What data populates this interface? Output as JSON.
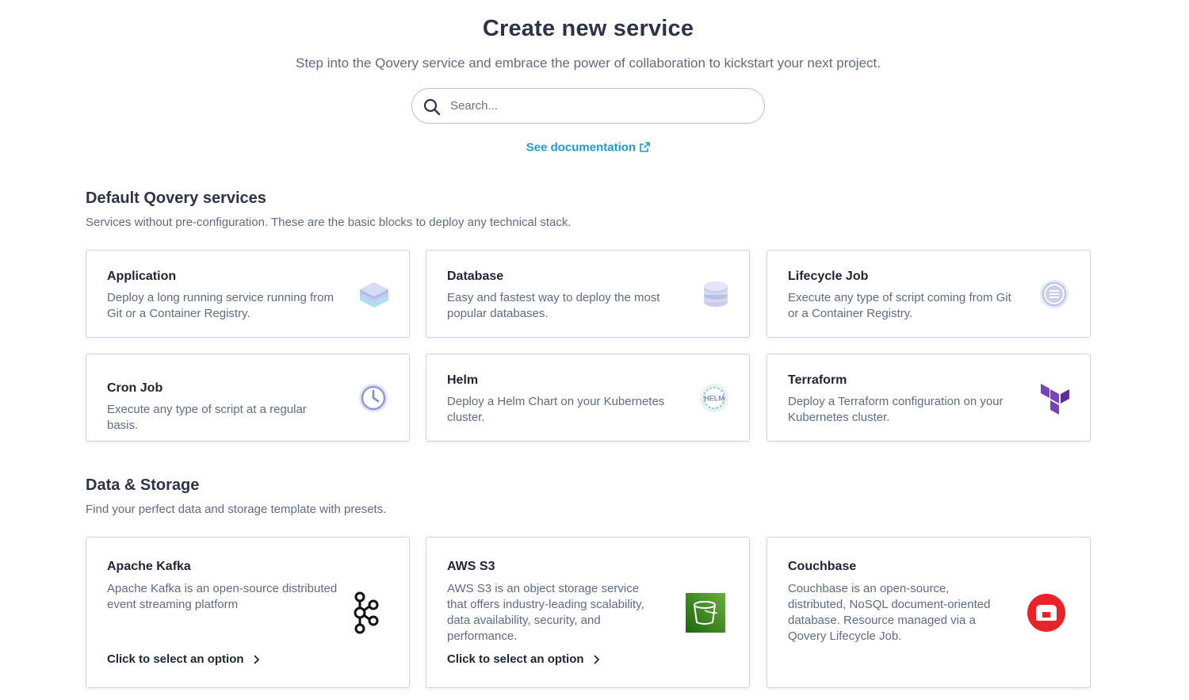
{
  "header": {
    "title": "Create new service",
    "subtitle": "Step into the Qovery service and embrace the power of collaboration to kickstart your next project.",
    "search_placeholder": "Search...",
    "doc_link": "See documentation"
  },
  "sections": [
    {
      "title": "Default Qovery services",
      "description": "Services without pre-configuration. These are the basic blocks to deploy any technical stack.",
      "cards": [
        {
          "title": "Application",
          "description": "Deploy a long running service running from Git or a Container Registry.",
          "icon": "layers-icon"
        },
        {
          "title": "Database",
          "description": "Easy and fastest way to deploy the most popular databases.",
          "icon": "database-icon"
        },
        {
          "title": "Lifecycle Job",
          "description": "Execute any type of script coming from Git or a Container Registry.",
          "icon": "lifecycle-job-icon"
        },
        {
          "title": "Cron Job",
          "description": "Execute any type of script at a regular basis.",
          "icon": "clock-icon"
        },
        {
          "title": "Helm",
          "description": "Deploy a Helm Chart on your Kubernetes cluster.",
          "icon": "helm-icon",
          "icon_text": "HELM"
        },
        {
          "title": "Terraform",
          "description": "Deploy a Terraform configuration on your Kubernetes cluster.",
          "icon": "terraform-icon"
        }
      ]
    },
    {
      "title": "Data & Storage",
      "description": "Find your perfect data and storage template with presets.",
      "cards": [
        {
          "title": "Apache Kafka",
          "description": "Apache Kafka is an open-source distributed event streaming platform",
          "cta": "Click to select an option",
          "icon": "kafka-icon"
        },
        {
          "title": "AWS S3",
          "description": "AWS S3 is an object storage service that offers industry-leading scalability, data availability, security, and performance.",
          "cta": "Click to select an option",
          "icon": "s3-bucket-icon"
        },
        {
          "title": "Couchbase",
          "description": "Couchbase is an open-source, distributed, NoSQL document-oriented database. Resource managed via a Qovery Lifecycle Job.",
          "icon": "couchbase-icon"
        }
      ]
    }
  ],
  "colors": {
    "link": "#1e9ad0",
    "terraform": "#7b42bc",
    "s3": "#3f8624",
    "couchbase": "#ea2328"
  }
}
